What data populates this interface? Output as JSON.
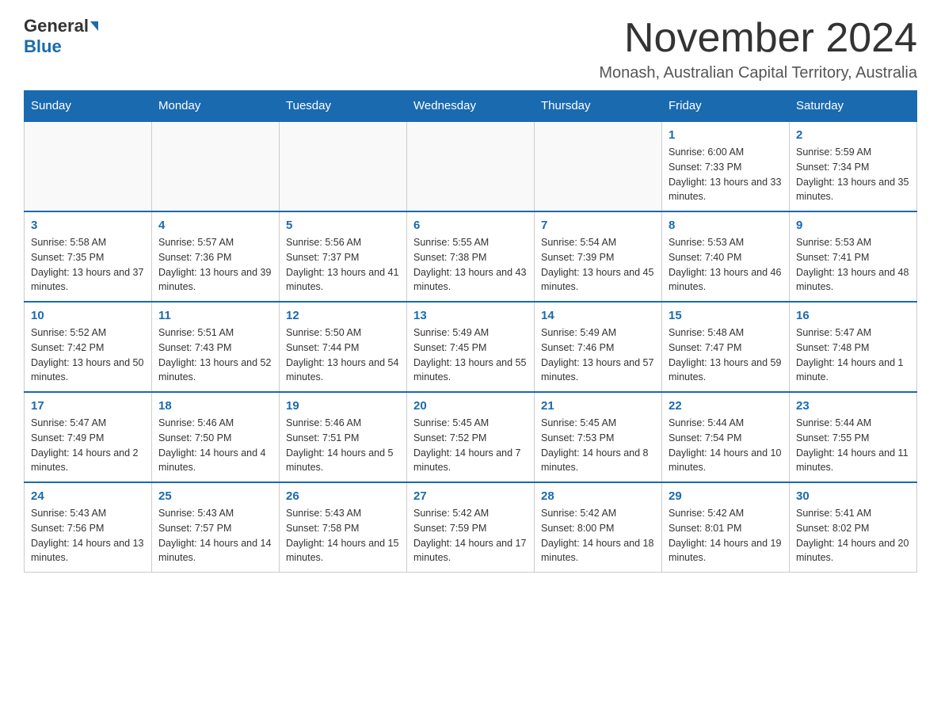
{
  "header": {
    "logo_general": "General",
    "logo_blue": "Blue",
    "month_title": "November 2024",
    "location": "Monash, Australian Capital Territory, Australia"
  },
  "days_of_week": [
    "Sunday",
    "Monday",
    "Tuesday",
    "Wednesday",
    "Thursday",
    "Friday",
    "Saturday"
  ],
  "weeks": [
    [
      {
        "day": "",
        "sunrise": "",
        "sunset": "",
        "daylight": ""
      },
      {
        "day": "",
        "sunrise": "",
        "sunset": "",
        "daylight": ""
      },
      {
        "day": "",
        "sunrise": "",
        "sunset": "",
        "daylight": ""
      },
      {
        "day": "",
        "sunrise": "",
        "sunset": "",
        "daylight": ""
      },
      {
        "day": "",
        "sunrise": "",
        "sunset": "",
        "daylight": ""
      },
      {
        "day": "1",
        "sunrise": "Sunrise: 6:00 AM",
        "sunset": "Sunset: 7:33 PM",
        "daylight": "Daylight: 13 hours and 33 minutes."
      },
      {
        "day": "2",
        "sunrise": "Sunrise: 5:59 AM",
        "sunset": "Sunset: 7:34 PM",
        "daylight": "Daylight: 13 hours and 35 minutes."
      }
    ],
    [
      {
        "day": "3",
        "sunrise": "Sunrise: 5:58 AM",
        "sunset": "Sunset: 7:35 PM",
        "daylight": "Daylight: 13 hours and 37 minutes."
      },
      {
        "day": "4",
        "sunrise": "Sunrise: 5:57 AM",
        "sunset": "Sunset: 7:36 PM",
        "daylight": "Daylight: 13 hours and 39 minutes."
      },
      {
        "day": "5",
        "sunrise": "Sunrise: 5:56 AM",
        "sunset": "Sunset: 7:37 PM",
        "daylight": "Daylight: 13 hours and 41 minutes."
      },
      {
        "day": "6",
        "sunrise": "Sunrise: 5:55 AM",
        "sunset": "Sunset: 7:38 PM",
        "daylight": "Daylight: 13 hours and 43 minutes."
      },
      {
        "day": "7",
        "sunrise": "Sunrise: 5:54 AM",
        "sunset": "Sunset: 7:39 PM",
        "daylight": "Daylight: 13 hours and 45 minutes."
      },
      {
        "day": "8",
        "sunrise": "Sunrise: 5:53 AM",
        "sunset": "Sunset: 7:40 PM",
        "daylight": "Daylight: 13 hours and 46 minutes."
      },
      {
        "day": "9",
        "sunrise": "Sunrise: 5:53 AM",
        "sunset": "Sunset: 7:41 PM",
        "daylight": "Daylight: 13 hours and 48 minutes."
      }
    ],
    [
      {
        "day": "10",
        "sunrise": "Sunrise: 5:52 AM",
        "sunset": "Sunset: 7:42 PM",
        "daylight": "Daylight: 13 hours and 50 minutes."
      },
      {
        "day": "11",
        "sunrise": "Sunrise: 5:51 AM",
        "sunset": "Sunset: 7:43 PM",
        "daylight": "Daylight: 13 hours and 52 minutes."
      },
      {
        "day": "12",
        "sunrise": "Sunrise: 5:50 AM",
        "sunset": "Sunset: 7:44 PM",
        "daylight": "Daylight: 13 hours and 54 minutes."
      },
      {
        "day": "13",
        "sunrise": "Sunrise: 5:49 AM",
        "sunset": "Sunset: 7:45 PM",
        "daylight": "Daylight: 13 hours and 55 minutes."
      },
      {
        "day": "14",
        "sunrise": "Sunrise: 5:49 AM",
        "sunset": "Sunset: 7:46 PM",
        "daylight": "Daylight: 13 hours and 57 minutes."
      },
      {
        "day": "15",
        "sunrise": "Sunrise: 5:48 AM",
        "sunset": "Sunset: 7:47 PM",
        "daylight": "Daylight: 13 hours and 59 minutes."
      },
      {
        "day": "16",
        "sunrise": "Sunrise: 5:47 AM",
        "sunset": "Sunset: 7:48 PM",
        "daylight": "Daylight: 14 hours and 1 minute."
      }
    ],
    [
      {
        "day": "17",
        "sunrise": "Sunrise: 5:47 AM",
        "sunset": "Sunset: 7:49 PM",
        "daylight": "Daylight: 14 hours and 2 minutes."
      },
      {
        "day": "18",
        "sunrise": "Sunrise: 5:46 AM",
        "sunset": "Sunset: 7:50 PM",
        "daylight": "Daylight: 14 hours and 4 minutes."
      },
      {
        "day": "19",
        "sunrise": "Sunrise: 5:46 AM",
        "sunset": "Sunset: 7:51 PM",
        "daylight": "Daylight: 14 hours and 5 minutes."
      },
      {
        "day": "20",
        "sunrise": "Sunrise: 5:45 AM",
        "sunset": "Sunset: 7:52 PM",
        "daylight": "Daylight: 14 hours and 7 minutes."
      },
      {
        "day": "21",
        "sunrise": "Sunrise: 5:45 AM",
        "sunset": "Sunset: 7:53 PM",
        "daylight": "Daylight: 14 hours and 8 minutes."
      },
      {
        "day": "22",
        "sunrise": "Sunrise: 5:44 AM",
        "sunset": "Sunset: 7:54 PM",
        "daylight": "Daylight: 14 hours and 10 minutes."
      },
      {
        "day": "23",
        "sunrise": "Sunrise: 5:44 AM",
        "sunset": "Sunset: 7:55 PM",
        "daylight": "Daylight: 14 hours and 11 minutes."
      }
    ],
    [
      {
        "day": "24",
        "sunrise": "Sunrise: 5:43 AM",
        "sunset": "Sunset: 7:56 PM",
        "daylight": "Daylight: 14 hours and 13 minutes."
      },
      {
        "day": "25",
        "sunrise": "Sunrise: 5:43 AM",
        "sunset": "Sunset: 7:57 PM",
        "daylight": "Daylight: 14 hours and 14 minutes."
      },
      {
        "day": "26",
        "sunrise": "Sunrise: 5:43 AM",
        "sunset": "Sunset: 7:58 PM",
        "daylight": "Daylight: 14 hours and 15 minutes."
      },
      {
        "day": "27",
        "sunrise": "Sunrise: 5:42 AM",
        "sunset": "Sunset: 7:59 PM",
        "daylight": "Daylight: 14 hours and 17 minutes."
      },
      {
        "day": "28",
        "sunrise": "Sunrise: 5:42 AM",
        "sunset": "Sunset: 8:00 PM",
        "daylight": "Daylight: 14 hours and 18 minutes."
      },
      {
        "day": "29",
        "sunrise": "Sunrise: 5:42 AM",
        "sunset": "Sunset: 8:01 PM",
        "daylight": "Daylight: 14 hours and 19 minutes."
      },
      {
        "day": "30",
        "sunrise": "Sunrise: 5:41 AM",
        "sunset": "Sunset: 8:02 PM",
        "daylight": "Daylight: 14 hours and 20 minutes."
      }
    ]
  ]
}
